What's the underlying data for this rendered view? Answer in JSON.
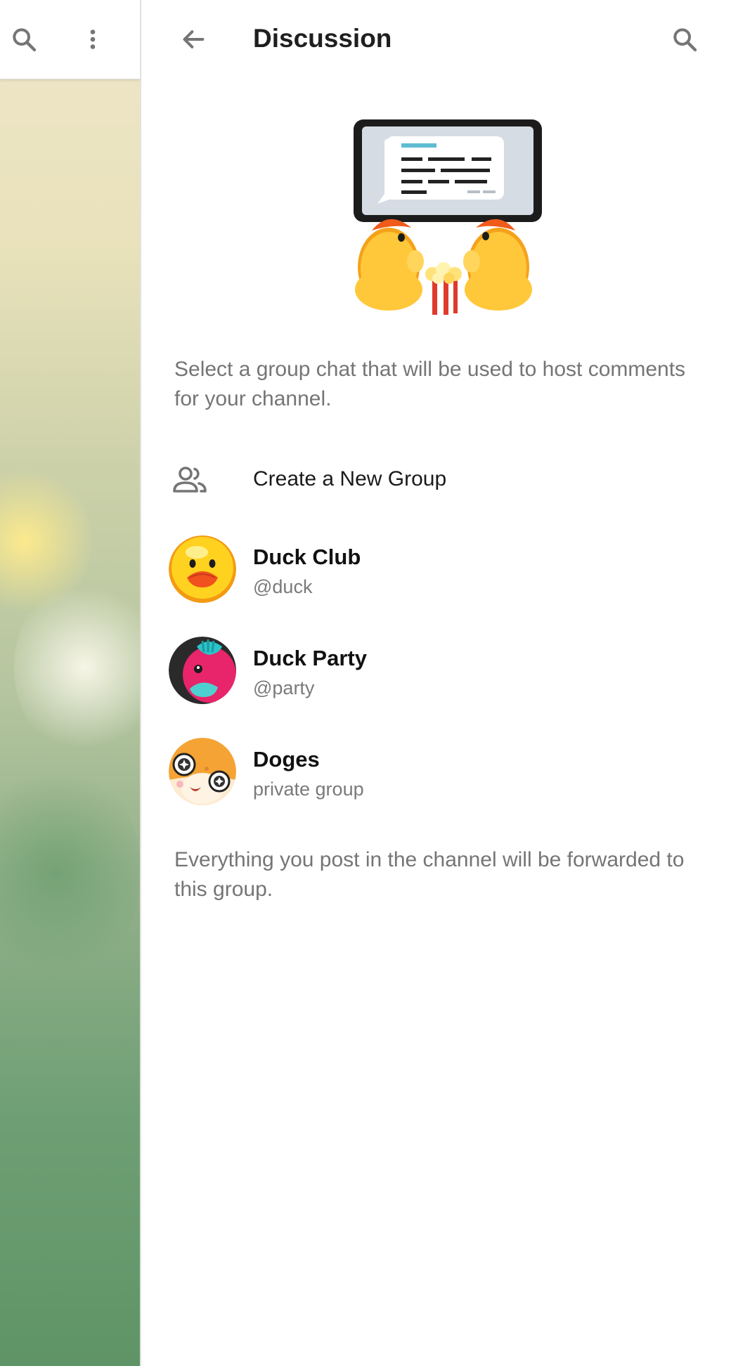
{
  "header": {
    "title": "Discussion"
  },
  "intro_text": "Select a group chat that will be used to host comments for your channel.",
  "create_group_label": "Create a New Group",
  "groups": [
    {
      "name": "Duck Club",
      "subtitle": "@duck"
    },
    {
      "name": "Duck Party",
      "subtitle": "@party"
    },
    {
      "name": "Doges",
      "subtitle": "private group"
    }
  ],
  "footer_text": "Everything you post in the channel will be forwarded to this group.",
  "icons": {
    "left_search": "search-icon",
    "left_menu": "more-vertical-icon",
    "back": "arrow-left-icon",
    "search": "search-icon",
    "create_group": "group-icon"
  },
  "colors": {
    "icon_gray": "#757575",
    "title": "#1f1f1f",
    "secondary_text": "#757575"
  }
}
